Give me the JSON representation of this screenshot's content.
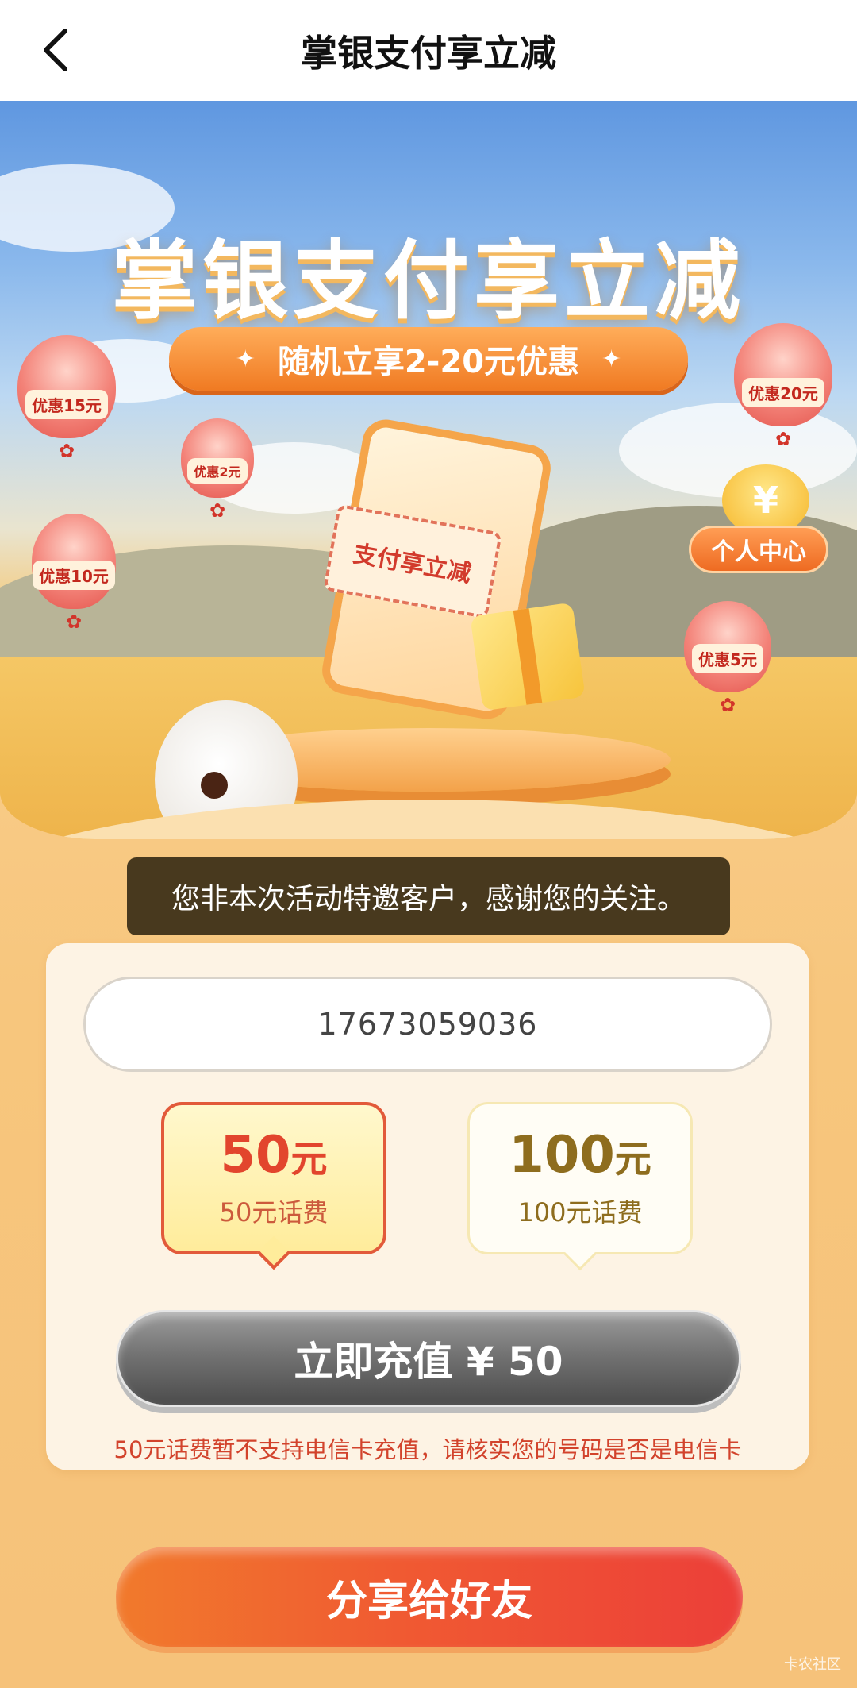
{
  "navbar": {
    "title": "掌银支付享立减",
    "back_icon": "chevron-left-icon"
  },
  "hero": {
    "title": "掌银支付享立减",
    "promo_pill": "随机立享2-20元优惠",
    "balloons": {
      "b15": "优惠15元",
      "b2": "优惠2元",
      "b10": "优惠10元",
      "b20": "优惠20元",
      "b5": "优惠5元"
    },
    "ticket_text": "支付享立减",
    "personal_center": "个人中心",
    "coin_symbol": "¥"
  },
  "toast": {
    "message": "您非本次活动特邀客户，感谢您的关注。"
  },
  "form": {
    "phone_value": "17673059036",
    "options": [
      {
        "price": "50",
        "unit": "元",
        "sub": "50元话费",
        "selected": true
      },
      {
        "price": "100",
        "unit": "元",
        "sub": "100元话费",
        "selected": false
      }
    ],
    "recharge_button": "立即充值 ¥ 50",
    "notice": "50元话费暂不支持电信卡充值，请核实您的号码是否是电信卡"
  },
  "share_button": "分享给好友",
  "watermark": "卡农社区",
  "colors": {
    "accent_orange": "#f07a22",
    "selected_border": "#e25a3a",
    "notice_red": "#d2432c",
    "disabled_button": "#737373"
  }
}
